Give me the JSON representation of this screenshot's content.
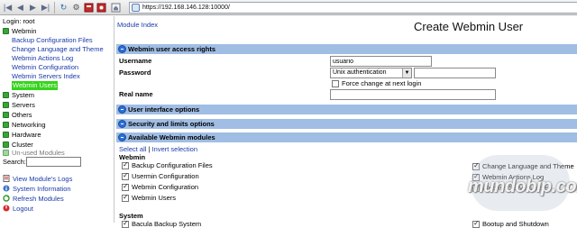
{
  "browser": {
    "url": "https://192.168.146.128:10000/"
  },
  "sidebar": {
    "login": "Login: root",
    "categories": [
      {
        "label": "Webmin"
      },
      {
        "label": "System"
      },
      {
        "label": "Servers"
      },
      {
        "label": "Others"
      },
      {
        "label": "Networking"
      },
      {
        "label": "Hardware"
      },
      {
        "label": "Cluster"
      },
      {
        "label": "Un-used Modules"
      }
    ],
    "webmin_items": [
      {
        "label": "Backup Configuration Files"
      },
      {
        "label": "Change Language and Theme"
      },
      {
        "label": "Webmin Actions Log"
      },
      {
        "label": "Webmin Configuration"
      },
      {
        "label": "Webmin Servers Index"
      },
      {
        "label": "Webmin Users"
      }
    ],
    "search_label": "Search:",
    "search_value": "",
    "links": [
      {
        "label": "View Module's Logs"
      },
      {
        "label": "System Information"
      },
      {
        "label": "Refresh Modules"
      },
      {
        "label": "Logout"
      }
    ]
  },
  "main": {
    "module_index": "Module Index",
    "title": "Create Webmin User",
    "sections": {
      "access_rights": "Webmin user access rights",
      "ui_options": "User interface options",
      "security": "Security and limits options",
      "modules": "Available Webmin modules"
    },
    "form": {
      "username_label": "Username",
      "username_value": "usuario",
      "password_label": "Password",
      "password_mode": "Unix authentication",
      "password_value": "",
      "force_change_label": "Force change at next login",
      "realname_label": "Real name",
      "realname_value": ""
    },
    "select_all": "Select all",
    "separator": "|",
    "invert_selection": "Invert selection",
    "webmin_heading": "Webmin",
    "webmin_modules_left": [
      {
        "label": "Backup Configuration Files",
        "checked": true
      },
      {
        "label": "Usermin Configuration",
        "checked": true
      },
      {
        "label": "Webmin Configuration",
        "checked": true
      },
      {
        "label": "Webmin Users",
        "checked": true
      }
    ],
    "webmin_modules_right": [
      {
        "label": "Change Language and Theme",
        "checked": true
      },
      {
        "label": "Webmin Actions Log",
        "checked": true
      },
      {
        "label": "Webmin Servers Index",
        "checked": true
      }
    ],
    "system_heading": "System",
    "system_modules_left": [
      {
        "label": "Bacula Backup System",
        "checked": true
      }
    ],
    "system_modules_right": [
      {
        "label": "Bootup and Shutdown",
        "checked": true
      }
    ]
  },
  "watermark": "mundobip.com"
}
